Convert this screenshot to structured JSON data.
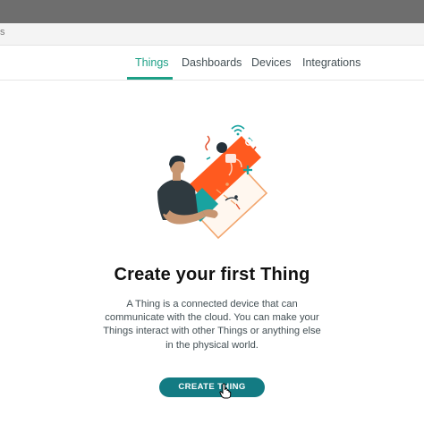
{
  "browser": {
    "address_text": "s"
  },
  "nav": {
    "tabs": [
      {
        "label": "Things",
        "active": true
      },
      {
        "label": "Dashboards",
        "active": false
      },
      {
        "label": "Devices",
        "active": false
      },
      {
        "label": "Integrations",
        "active": false
      }
    ]
  },
  "empty_state": {
    "title": "Create your first Thing",
    "description": "A Thing is a connected device that can communicate with the cloud. You can make your Things interact with other Things or anything else in the physical world.",
    "cta_label": "CREATE THING",
    "illustration_icon": "person-with-connected-devices-illustration"
  },
  "colors": {
    "accent": "#1da086",
    "button": "#137b83",
    "title": "#111111",
    "text": "#434f54",
    "illustration_orange": "#ff5a1f",
    "illustration_teal": "#19a3a0"
  }
}
